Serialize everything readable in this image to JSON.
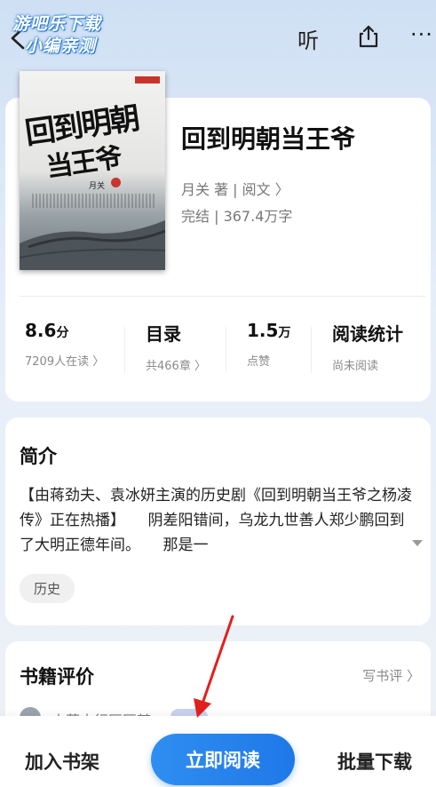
{
  "watermark": {
    "line1": "游吧乐下载",
    "line2": "小编亲测"
  },
  "header": {
    "listen_label": "听",
    "more_label": "···"
  },
  "book": {
    "cover": {
      "title_line1": "回到明朝",
      "title_line2": "当王爷",
      "author": "月关"
    },
    "title": "回到明朝当王爷",
    "meta": "月关 著 | 阅文 〉",
    "status": "完结 | 367.4万字"
  },
  "stats": [
    {
      "main": "8.6",
      "unit": "分",
      "sub": "7209人在读 〉"
    },
    {
      "main": "目录",
      "unit": "",
      "sub": "共466章 〉"
    },
    {
      "main": "1.5",
      "unit": "万",
      "sub": "点赞"
    },
    {
      "main": "阅读统计",
      "unit": "",
      "sub": "尚未阅读"
    }
  ],
  "intro": {
    "heading": "简介",
    "text": "【由蒋劲夫、袁冰妍主演的历史剧《回到明朝当王爷之杨凌传》正在热播】　　阴差阳错间，乌龙九世善人郑少鹏回到了大明正德年间。　　那是一",
    "tag": "历史"
  },
  "reviews": {
    "heading": "书籍评价",
    "write_label": "写书评 〉",
    "first_reviewer": "大草内行匠匠某"
  },
  "bottom": {
    "add_shelf": "加入书架",
    "read_now": "立即阅读",
    "batch_download": "批量下载"
  },
  "colors": {
    "accent": "#1f78e8",
    "arrow": "#e0201c"
  }
}
